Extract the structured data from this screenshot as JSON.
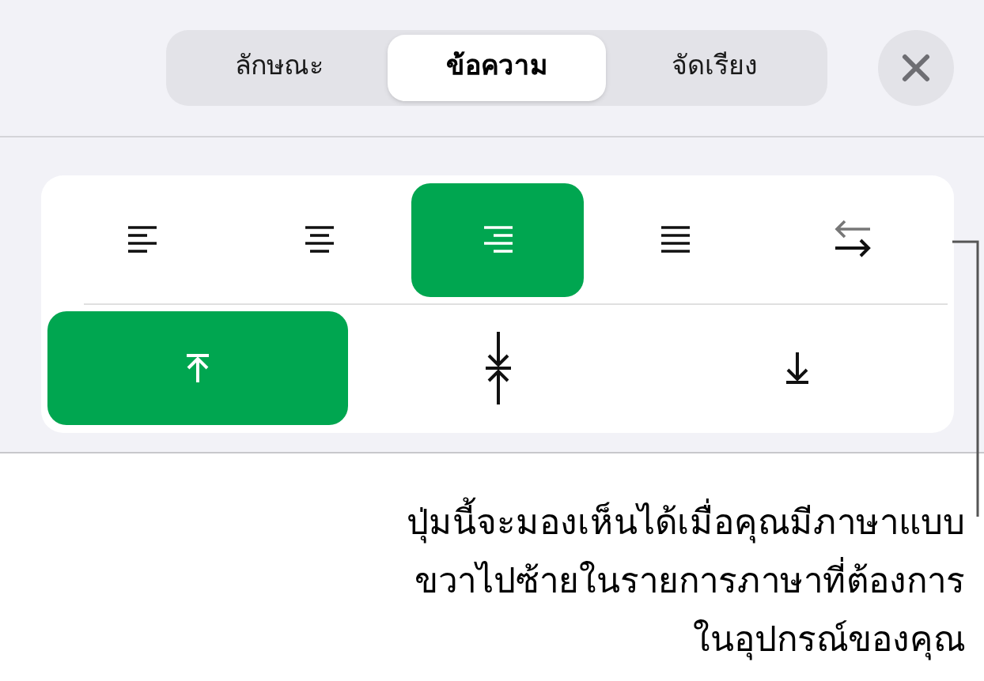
{
  "tabs": [
    {
      "label": "ลักษณะ",
      "selected": false
    },
    {
      "label": "ข้อความ",
      "selected": true
    },
    {
      "label": "จัดเรียง",
      "selected": false
    }
  ],
  "horizontal_alignment": [
    {
      "kind": "left",
      "selected": false
    },
    {
      "kind": "center",
      "selected": false
    },
    {
      "kind": "right",
      "selected": true
    },
    {
      "kind": "justify",
      "selected": false
    },
    {
      "kind": "direction",
      "selected": false
    }
  ],
  "vertical_alignment": [
    {
      "kind": "top",
      "selected": true
    },
    {
      "kind": "middle",
      "selected": false
    },
    {
      "kind": "bottom",
      "selected": false
    }
  ],
  "callout": [
    "ปุ่มนี้จะมองเห็นได้เมื่อคุณมีภาษาแบบ",
    "ขวาไปซ้ายในรายการภาษาที่ต้องการ",
    "ในอุปกรณ์ของคุณ"
  ]
}
